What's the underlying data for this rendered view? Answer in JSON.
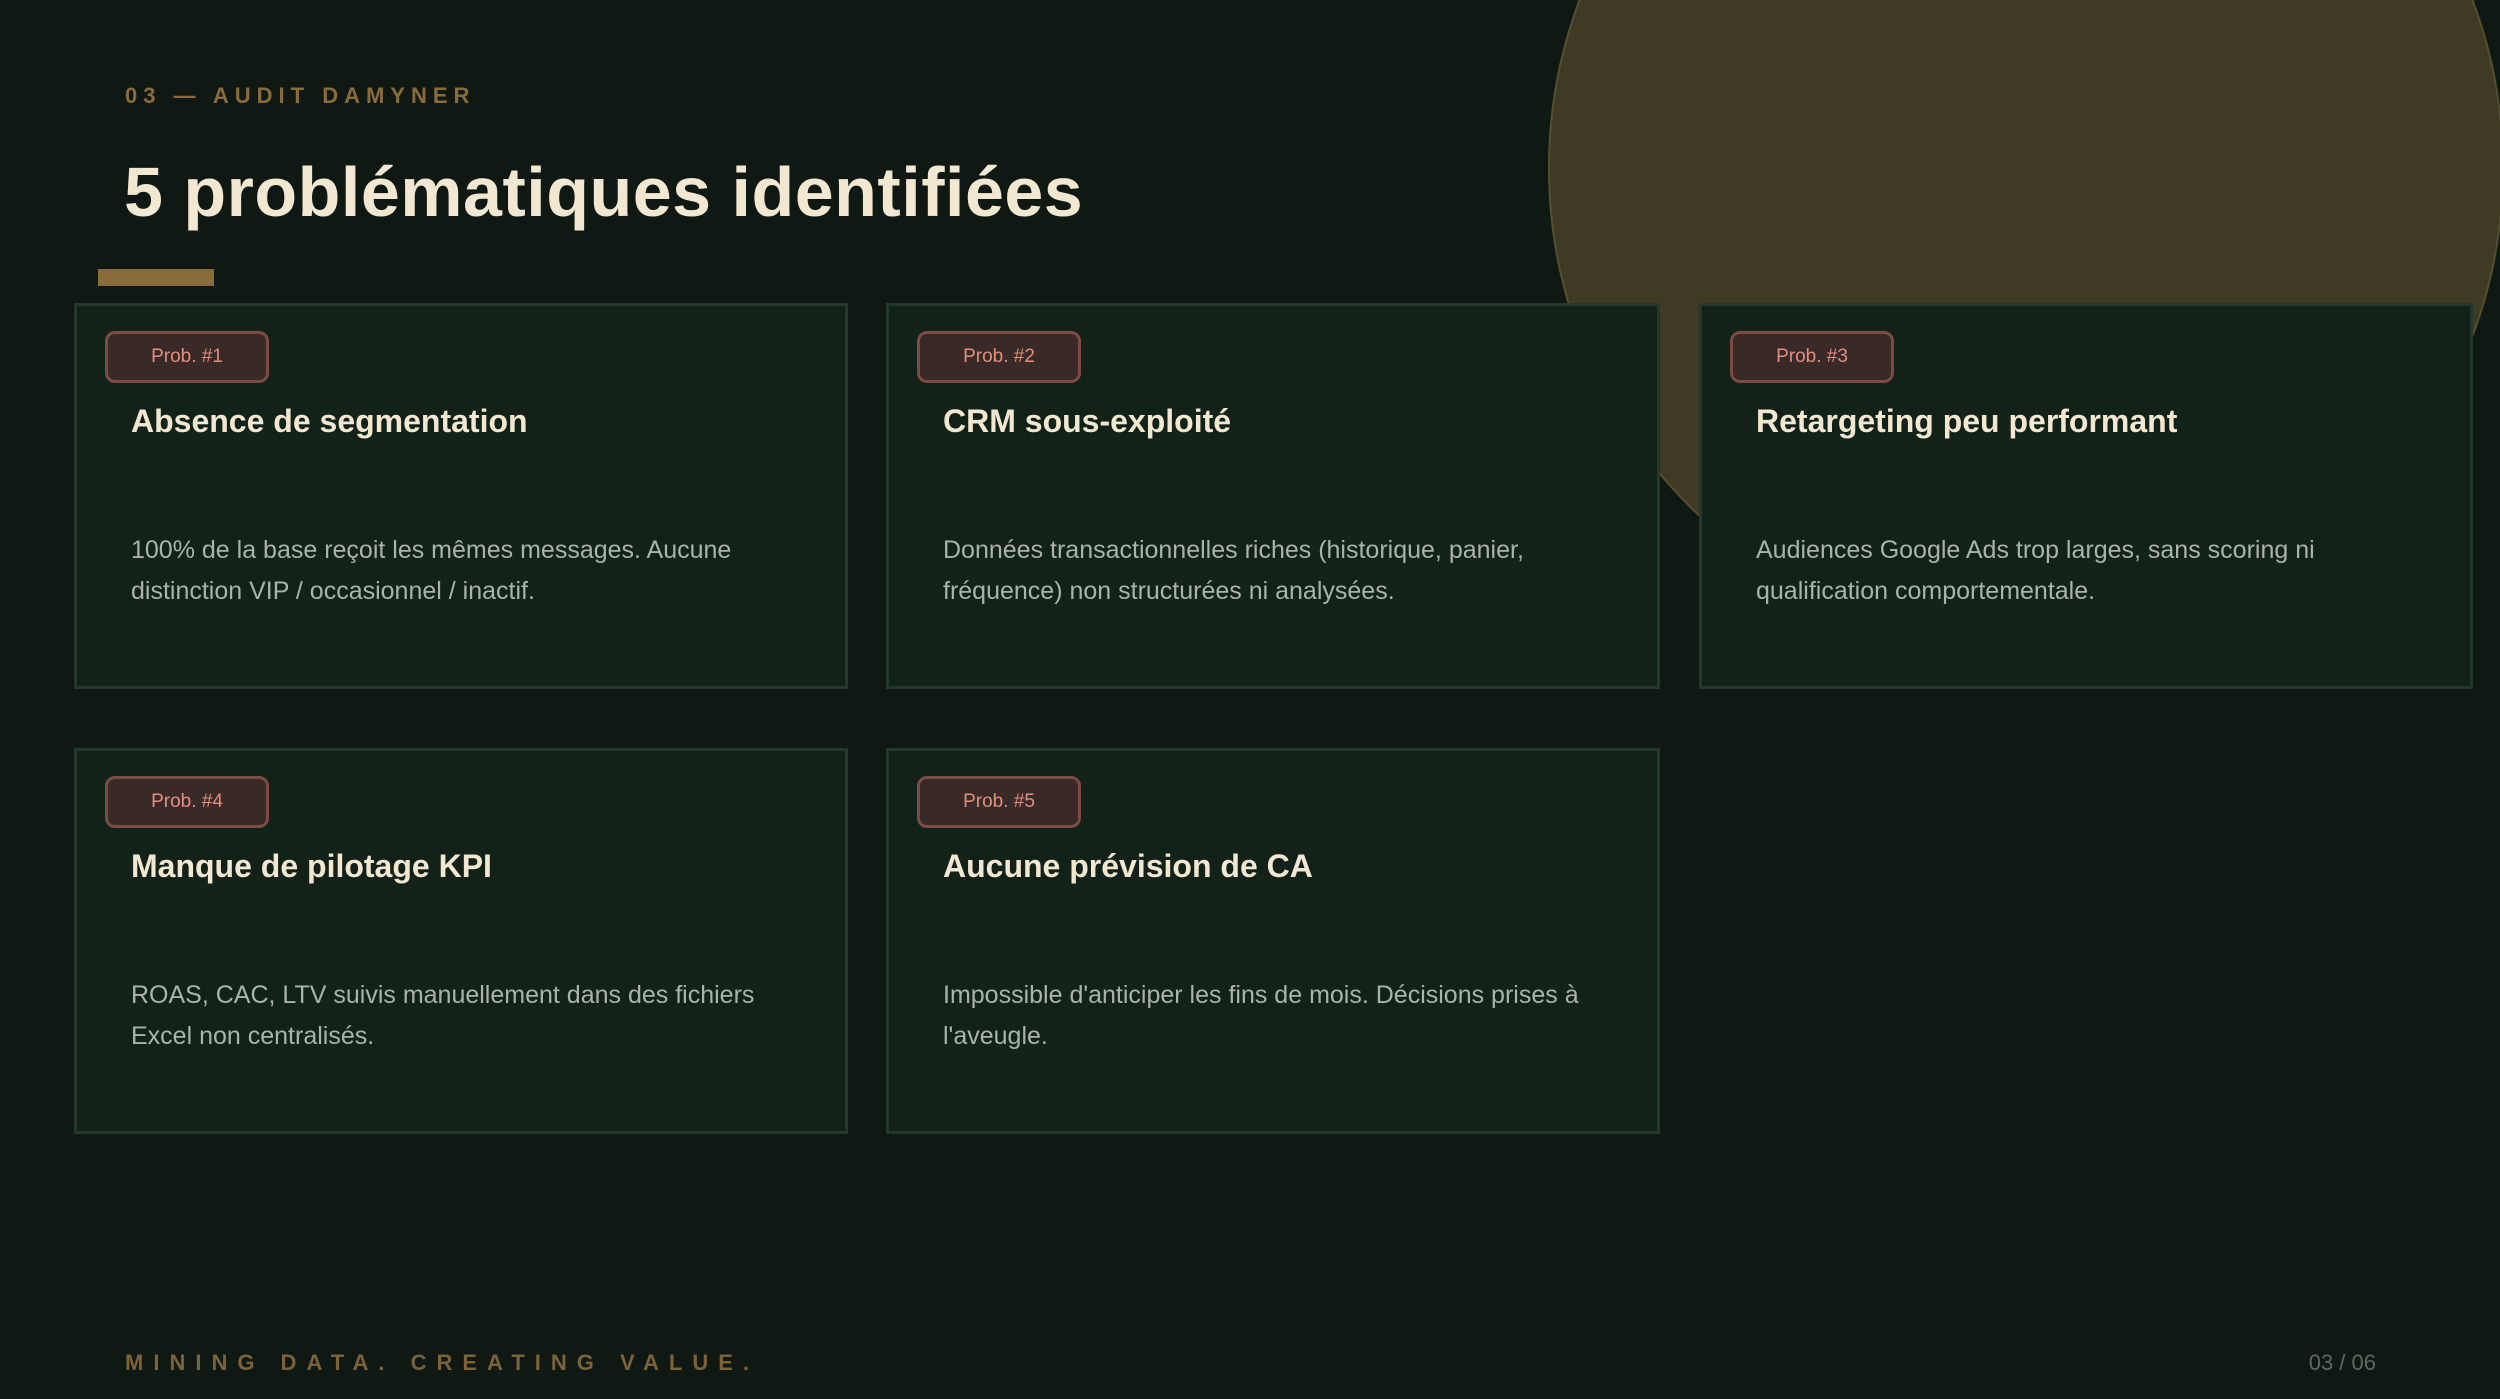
{
  "slide": {
    "kicker": "03 — AUDIT DAMYNER",
    "title": "5 problématiques identifiées"
  },
  "problems": [
    {
      "badge": "Prob. #1",
      "title": "Absence de segmentation",
      "description": "100% de la base reçoit les mêmes messages. Aucune distinction VIP / occasionnel / inactif."
    },
    {
      "badge": "Prob. #2",
      "title": "CRM sous-exploité",
      "description": "Données transactionnelles riches (historique, panier, fréquence) non structurées ni analysées."
    },
    {
      "badge": "Prob. #3",
      "title": "Retargeting peu performant",
      "description": "Audiences Google Ads trop larges, sans scoring ni qualification comportementale."
    },
    {
      "badge": "Prob. #4",
      "title": "Manque de pilotage KPI",
      "description": "ROAS, CAC, LTV suivis manuellement dans des fichiers Excel non centralisés."
    },
    {
      "badge": "Prob. #5",
      "title": "Aucune prévision de CA",
      "description": "Impossible d'anticiper les fins de mois. Décisions prises à l'aveugle."
    }
  ],
  "footer": {
    "tagline": "MINING DATA. CREATING VALUE.",
    "page_number": "03 / 06"
  },
  "colors": {
    "background": "#0f1812",
    "accent_gold": "#8a6c3a",
    "badge_text": "#e08e7e",
    "title_text": "#f2e8d2"
  }
}
